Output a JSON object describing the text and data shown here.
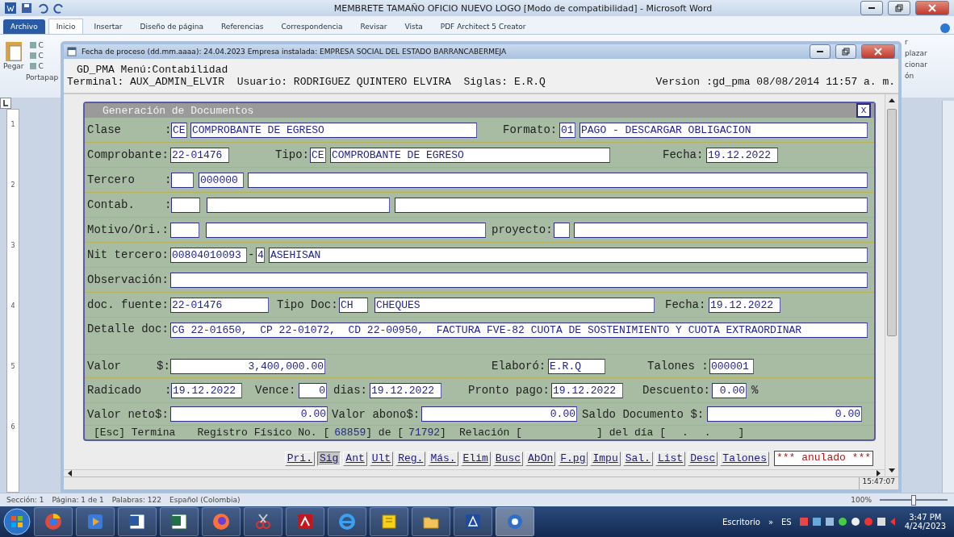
{
  "word": {
    "title": "MEMBRETE TAMAÑO OFICIO NUEVO LOGO [Modo de compatibilidad] - Microsoft Word",
    "tabs": [
      {
        "label": "Archivo",
        "kind": "file",
        "selected": false
      },
      {
        "label": "Inicio",
        "kind": "tab",
        "selected": true
      },
      {
        "label": "Insertar",
        "kind": "tab",
        "selected": false
      },
      {
        "label": "Diseño de página",
        "kind": "tab",
        "selected": false
      },
      {
        "label": "Referencias",
        "kind": "tab",
        "selected": false
      },
      {
        "label": "Correspondencia",
        "kind": "tab",
        "selected": false
      },
      {
        "label": "Revisar",
        "kind": "tab",
        "selected": false
      },
      {
        "label": "Vista",
        "kind": "tab",
        "selected": false
      },
      {
        "label": "PDF Architect 5 Creator",
        "kind": "tab",
        "selected": false
      }
    ],
    "paste": "Pegar",
    "clip_letters": [
      "C",
      "C",
      "C"
    ],
    "group": "Portapap",
    "right_ribbon": [
      "r",
      "plazar",
      "cionar",
      "ón"
    ],
    "ruler": [
      "1",
      "2",
      "3",
      "4",
      "5",
      "6"
    ],
    "status": [
      "Sección: 1",
      "Página: 1 de 1",
      "Palabras: 122",
      "Español (Colombia)"
    ],
    "zoom": {
      "label": "100%",
      "level": 0.5
    }
  },
  "app": {
    "title": "Fecha de proceso (dd.mm.aaaa): 24.04.2023  Empresa instalada: EMPRESA SOCIAL DEL ESTADO BARRANCABERMEJA",
    "menu": "GD_PMA Menú:Contabilidad",
    "session": "Terminal: AUX_ADMIN_ELVIR  Usuario: RODRIGUEZ QUINTERO ELVIRA  Siglas: E.R.Q",
    "version": "Version :gd_pma 08/08/2014 11:57 a. m.",
    "clock": "15:47:07"
  },
  "form": {
    "title": "Generación de Documentos",
    "close": "x",
    "rows": [
      {
        "items": [
          {
            "kind": "label",
            "text": "Clase"
          },
          {
            "kind": "label",
            "text": ":"
          },
          {
            "kind": "field",
            "value": "CE"
          },
          {
            "kind": "field",
            "value": "COMPROBANTE DE EGRESO"
          },
          {
            "kind": "label",
            "text": "Formato:"
          },
          {
            "kind": "field",
            "value": "01"
          },
          {
            "kind": "field",
            "value": "PAGO - DESCARGAR OBLIGACION"
          }
        ]
      },
      {
        "items": [
          {
            "kind": "label",
            "text": "Comprobante:"
          },
          {
            "kind": "field",
            "value": "22-01476"
          },
          {
            "kind": "label",
            "text": "Tipo:"
          },
          {
            "kind": "field",
            "value": "CE"
          },
          {
            "kind": "field",
            "value": "COMPROBANTE DE EGRESO"
          },
          {
            "kind": "label",
            "text": "Fecha:"
          },
          {
            "kind": "field",
            "value": "19.12.2022"
          }
        ]
      },
      {
        "items": [
          {
            "kind": "label",
            "text": "Tercero"
          },
          {
            "kind": "label",
            "text": ":"
          },
          {
            "kind": "field"
          },
          {
            "kind": "field",
            "value": "000000"
          },
          {
            "kind": "field"
          }
        ]
      },
      {
        "items": [
          {
            "kind": "label",
            "text": "Contab."
          },
          {
            "kind": "label",
            "text": ":"
          },
          {
            "kind": "field"
          },
          {
            "kind": "field"
          },
          {
            "kind": "field"
          }
        ]
      },
      {
        "items": [
          {
            "kind": "label",
            "text": "Motivo/Ori.:"
          },
          {
            "kind": "field"
          },
          {
            "kind": "field"
          },
          {
            "kind": "label",
            "text": "proyecto:"
          },
          {
            "kind": "field"
          },
          {
            "kind": "field"
          }
        ]
      },
      {
        "items": [
          {
            "kind": "label",
            "text": "Nit tercero:"
          },
          {
            "kind": "field",
            "value": "00804010093"
          },
          {
            "kind": "label",
            "text": "-"
          },
          {
            "kind": "field",
            "value": "4"
          },
          {
            "kind": "field",
            "value": "ASEHISAN"
          }
        ]
      },
      {
        "items": [
          {
            "kind": "label",
            "text": "Observación:"
          },
          {
            "kind": "field"
          }
        ]
      },
      {
        "items": [
          {
            "kind": "label",
            "text": "doc. fuente:"
          },
          {
            "kind": "field",
            "value": "22-01476"
          },
          {
            "kind": "label",
            "text": "Tipo Doc:"
          },
          {
            "kind": "field",
            "value": "CH"
          },
          {
            "kind": "field",
            "value": "CHEQUES"
          },
          {
            "kind": "label",
            "text": "Fecha:"
          },
          {
            "kind": "field",
            "value": "19.12.2022"
          }
        ]
      },
      {
        "items": [
          {
            "kind": "label",
            "text": "Detalle doc:"
          },
          {
            "kind": "field",
            "value": "CG 22-01650,  CP 22-01072,  CD 22-00950,  FACTURA FVE-82 CUOTA DE SOSTENIMIENTO Y CUOTA EXTRAORDINAR"
          }
        ]
      },
      {
        "items": [
          {
            "kind": "label",
            "text": "Valor"
          },
          {
            "kind": "label",
            "text": "$:"
          },
          {
            "kind": "amount",
            "value": "3,400,000.00"
          },
          {
            "kind": "label",
            "text": "Elaboró:"
          },
          {
            "kind": "field",
            "value": "E.R.Q"
          },
          {
            "kind": "label",
            "text": "Talones :"
          },
          {
            "kind": "field",
            "value": "000001"
          }
        ]
      },
      {
        "items": [
          {
            "kind": "label",
            "text": "Radicado"
          },
          {
            "kind": "label",
            "text": ":"
          },
          {
            "kind": "field",
            "value": "19.12.2022"
          },
          {
            "kind": "label",
            "text": "Vence:"
          },
          {
            "kind": "amount",
            "value": "0"
          },
          {
            "kind": "label",
            "text": "dias:"
          },
          {
            "kind": "field",
            "value": "19.12.2022"
          },
          {
            "kind": "label",
            "text": "Pronto pago:"
          },
          {
            "kind": "field",
            "value": "19.12.2022"
          },
          {
            "kind": "label",
            "text": "Descuento:"
          },
          {
            "kind": "amount",
            "value": "0.00"
          },
          {
            "kind": "label",
            "text": "%"
          }
        ]
      },
      {
        "items": [
          {
            "kind": "label",
            "text": "Valor neto$:"
          },
          {
            "kind": "amount",
            "value": "0.00"
          },
          {
            "kind": "label",
            "text": "Valor abono$:"
          },
          {
            "kind": "amount",
            "value": "0.00"
          },
          {
            "kind": "label",
            "text": "Saldo Documento $:"
          },
          {
            "kind": "amount",
            "value": "0.00"
          }
        ]
      }
    ],
    "status_line": [
      {
        "kind": "text",
        "text": "[Esc] Termina"
      },
      {
        "kind": "text",
        "text": "Registro Físico No. ["
      },
      {
        "kind": "value",
        "text": "68859"
      },
      {
        "kind": "text",
        "text": "] de ["
      },
      {
        "kind": "value",
        "text": "71792"
      },
      {
        "kind": "text",
        "text": "]"
      },
      {
        "kind": "text",
        "text": "Relación ["
      },
      {
        "kind": "text",
        "text": "]"
      },
      {
        "kind": "text",
        "text": "del día ["
      },
      {
        "kind": "text",
        "text": "."
      },
      {
        "kind": "text",
        "text": "."
      },
      {
        "kind": "text",
        "text": "]"
      }
    ]
  },
  "buttons": [
    {
      "label": "Pri.",
      "selected": false
    },
    {
      "label": "Sig",
      "selected": true
    },
    {
      "label": "Ant",
      "selected": false
    },
    {
      "label": "Ult",
      "selected": false
    },
    {
      "label": "Reg.",
      "selected": false
    },
    {
      "label": "Más.",
      "selected": false
    },
    {
      "label": "Elim",
      "selected": false
    },
    {
      "label": "Busc",
      "selected": false
    },
    {
      "label": "AbOn",
      "selected": false
    },
    {
      "label": "F.pg",
      "selected": false
    },
    {
      "label": "Impu",
      "selected": false
    },
    {
      "label": "Sal.",
      "selected": false
    },
    {
      "label": "List",
      "selected": false
    },
    {
      "label": "Desc",
      "selected": false
    },
    {
      "label": "Talones",
      "selected": false
    }
  ],
  "annulled": "*** anulado ***",
  "taskbar": {
    "desktop": "Escritorio",
    "chevron": "»",
    "lang": "ES",
    "time": "3:47 PM",
    "date": "4/24/2023"
  }
}
